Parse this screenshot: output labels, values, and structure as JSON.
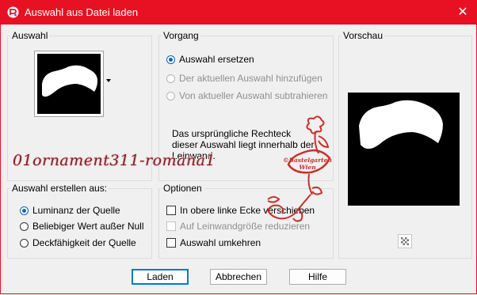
{
  "window": {
    "title": "Auswahl aus Datei laden",
    "close_glyph": "✕"
  },
  "auswahl_group": {
    "label": "Auswahl"
  },
  "vorgang_group": {
    "label": "Vorgang",
    "options": [
      {
        "label": "Auswahl ersetzen",
        "checked": true,
        "disabled": false
      },
      {
        "label": "Der aktuellen Auswahl hinzufügen",
        "checked": false,
        "disabled": true
      },
      {
        "label": "Von aktueller Auswahl subtrahieren",
        "checked": false,
        "disabled": true
      }
    ],
    "info_text": "Das ursprüngliche Rechteck dieser Auswahl liegt innerhalb der Leinwand."
  },
  "vorschau_group": {
    "label": "Vorschau"
  },
  "erstellen_group": {
    "label": "Auswahl erstellen aus:",
    "options": [
      {
        "label": "Luminanz der Quelle",
        "checked": true
      },
      {
        "label": "Beliebiger Wert außer Null",
        "checked": false
      },
      {
        "label": "Deckfähigkeit der Quelle",
        "checked": false
      }
    ]
  },
  "optionen_group": {
    "label": "Optionen",
    "options": [
      {
        "label": "In obere linke Ecke verschieben",
        "checked": false,
        "disabled": false
      },
      {
        "label": "Auf Leinwandgröße reduzieren",
        "checked": false,
        "disabled": true
      },
      {
        "label": "Auswahl umkehren",
        "checked": false,
        "disabled": false
      }
    ]
  },
  "buttons": {
    "load": "Laden",
    "cancel": "Abbrechen",
    "help": "Hilfe"
  },
  "watermark": {
    "name": "01ornament311-romana1",
    "stamp_line1": "©Bastelgarten",
    "stamp_line2": "Wien"
  },
  "colors": {
    "title_bar": "#e81123",
    "accent": "#0067c0",
    "stamp": "#c9302c"
  }
}
